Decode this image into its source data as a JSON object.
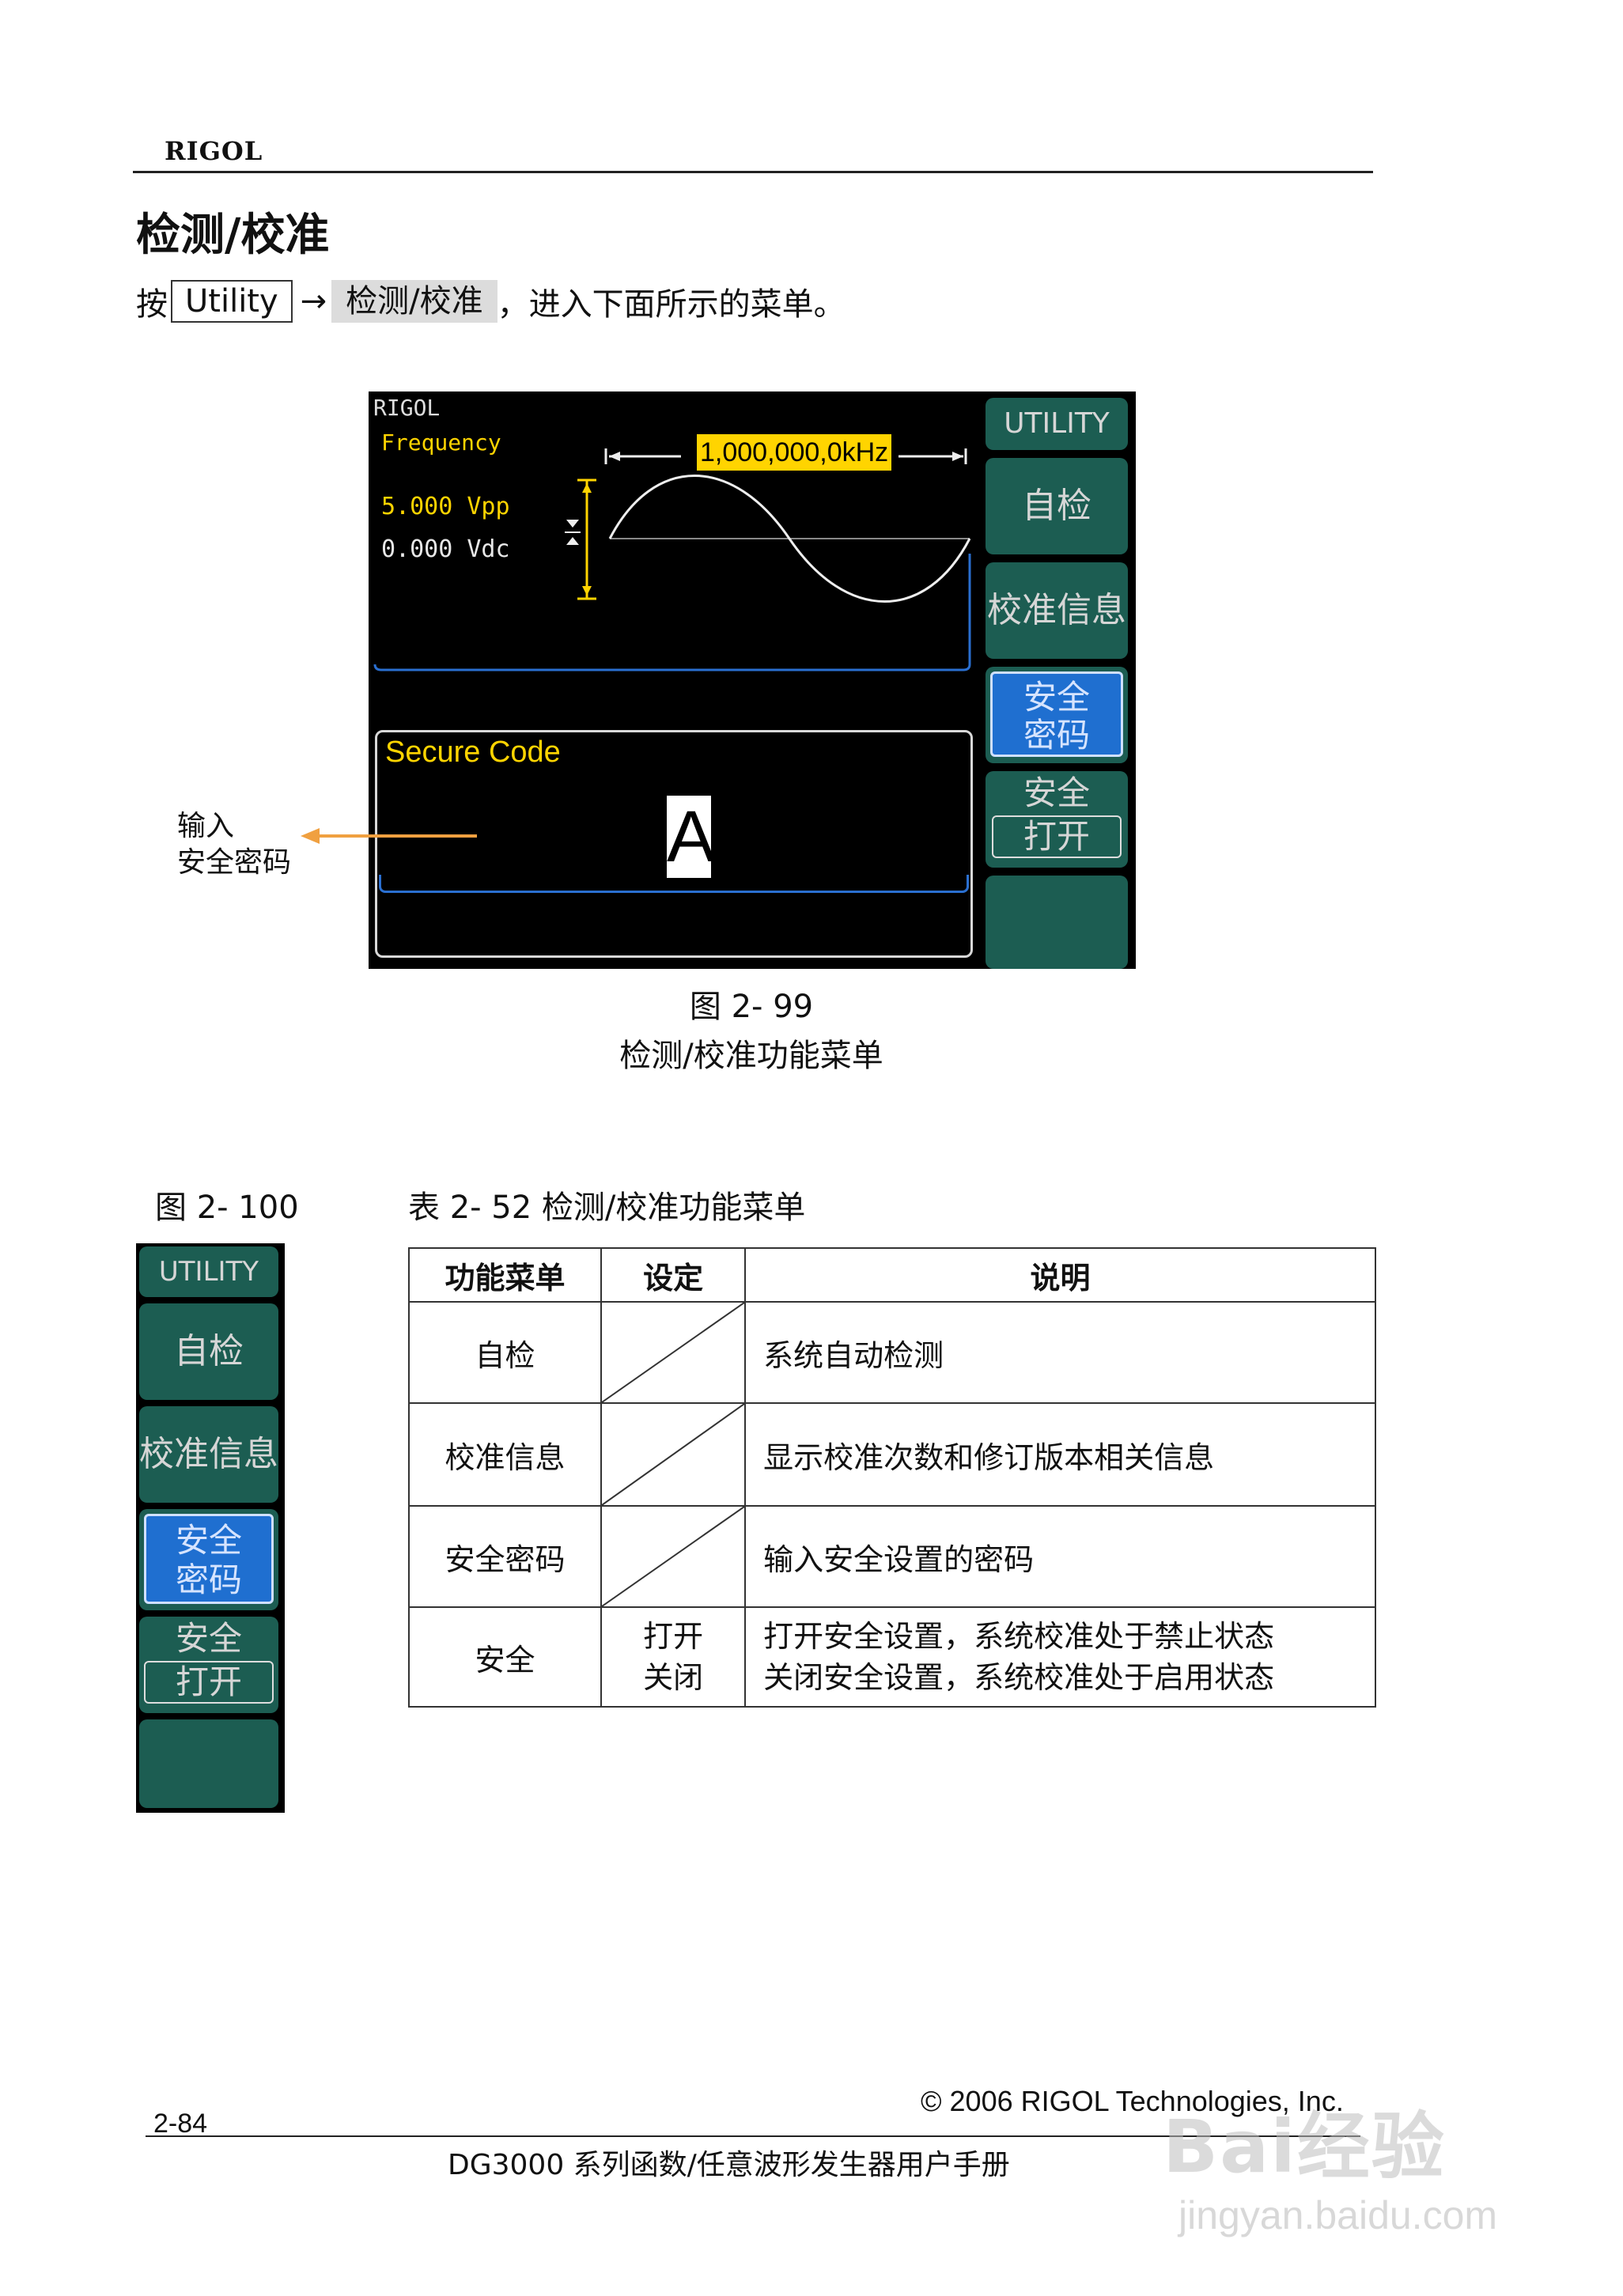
{
  "header": {
    "brand": "RIGOL"
  },
  "section_title": "检测/校准",
  "instruction": {
    "press": "按",
    "key": "Utility",
    "arrow": "→",
    "softkey": "检测/校准",
    "tail": "，进入下面所示的菜单。"
  },
  "screen": {
    "brand": "RIGOL",
    "param_label": "Frequency",
    "freq_value": "1,000,000,0kHz",
    "amplitude": "5.000 Vpp",
    "offset": "0.000 Vdc",
    "input_title": "Secure Code",
    "input_char": "A",
    "menu": {
      "title": "UTILITY",
      "self_test": "自检",
      "cal_info": "校准信息",
      "sec_code_1": "安全",
      "sec_code_2": "密码",
      "security": "安全",
      "security_state": "打开"
    }
  },
  "annotation": {
    "line1": "输入",
    "line2": "安全密码"
  },
  "fig99": {
    "number": "图 2- 99",
    "caption": "检测/校准功能菜单"
  },
  "fig100": {
    "number": "图 2- 100"
  },
  "table_caption": "表 2- 52 检测/校准功能菜单",
  "table": {
    "headers": [
      "功能菜单",
      "设定",
      "说明"
    ],
    "rows": [
      {
        "menu": "自检",
        "setting": "",
        "desc": "系统自动检测"
      },
      {
        "menu": "校准信息",
        "setting": "",
        "desc": "显示校准次数和修订版本相关信息"
      },
      {
        "menu": "安全密码",
        "setting": "",
        "desc": "输入安全设置的密码"
      },
      {
        "menu": "安全",
        "setting_1": "打开",
        "setting_2": "关闭",
        "desc_1": "打开安全设置，系统校准处于禁止状态",
        "desc_2": "关闭安全设置，系统校准处于启用状态"
      }
    ]
  },
  "footer": {
    "page": "2-84",
    "copyright": "© 2006 RIGOL Technologies, Inc.",
    "manual": "DG3000 系列函数/任意波形发生器用户手册"
  },
  "watermark": {
    "text": "Bai经验",
    "url": "jingyan.baidu.com"
  },
  "colors": {
    "screen_bg": "#000000",
    "menu_green": "#1c5d52",
    "active_blue": "#1f6fd0",
    "yellow": "#ffd400",
    "arrow_orange": "#f0a040"
  }
}
